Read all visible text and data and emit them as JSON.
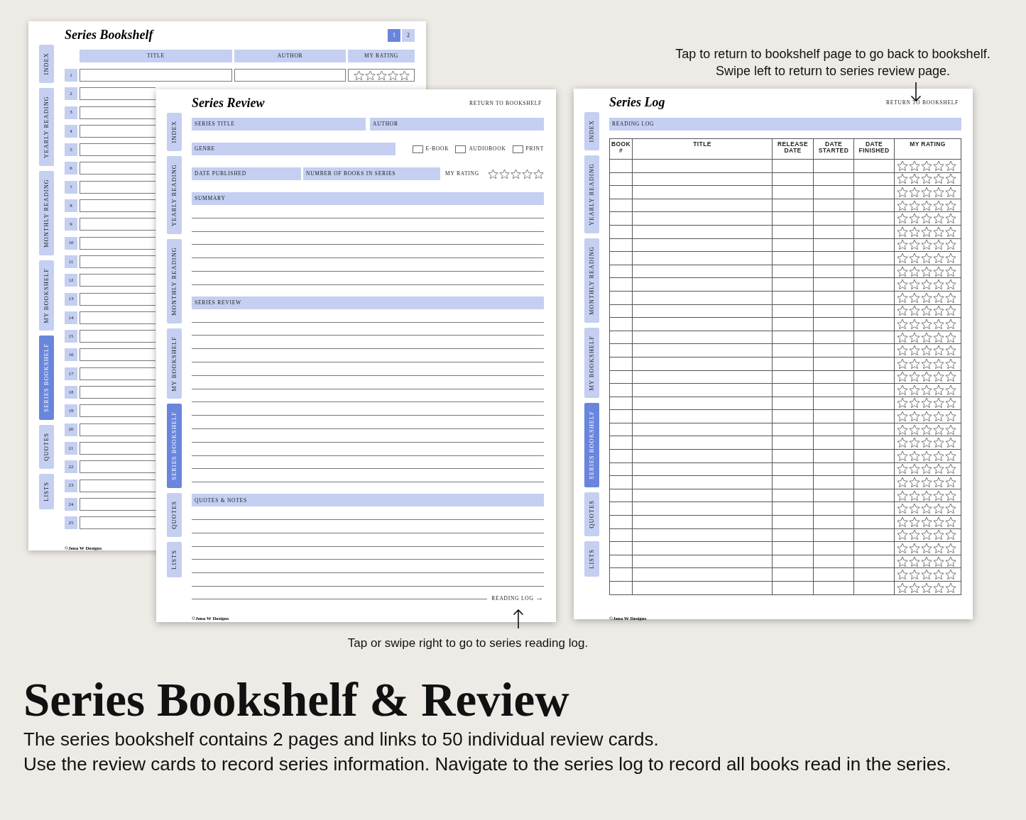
{
  "annotations": {
    "top_note": [
      "Tap to return to bookshelf page to go back to bookshelf.",
      "Swipe left to return to series review page."
    ],
    "bottom_note": "Tap or swipe right to go to series reading log."
  },
  "bookshelf_page": {
    "title": "Series Bookshelf",
    "page_buttons": [
      {
        "label": "1",
        "selected": true
      },
      {
        "label": "2",
        "selected": false
      }
    ],
    "tabs": [
      {
        "label": "INDEX",
        "selected": false
      },
      {
        "label": "YEARLY READING",
        "selected": false
      },
      {
        "label": "MONTHLY READING",
        "selected": false
      },
      {
        "label": "MY BOOKSHELF",
        "selected": false
      },
      {
        "label": "SERIES BOOKSHELF",
        "selected": true
      },
      {
        "label": "QUOTES",
        "selected": false
      },
      {
        "label": "LISTS",
        "selected": false
      }
    ],
    "columns": [
      "TITLE",
      "AUTHOR",
      "MY RATING"
    ],
    "rows": [
      {
        "number": "1",
        "stars": 0
      },
      {
        "number": "2"
      },
      {
        "number": "3"
      },
      {
        "number": "4"
      },
      {
        "number": "5"
      },
      {
        "number": "6"
      },
      {
        "number": "7"
      },
      {
        "number": "8"
      },
      {
        "number": "9"
      },
      {
        "number": "10"
      },
      {
        "number": "11"
      },
      {
        "number": "12"
      },
      {
        "number": "13"
      },
      {
        "number": "14"
      },
      {
        "number": "15"
      },
      {
        "number": "16"
      },
      {
        "number": "17"
      },
      {
        "number": "18"
      },
      {
        "number": "19"
      },
      {
        "number": "20"
      },
      {
        "number": "21"
      },
      {
        "number": "22"
      },
      {
        "number": "23"
      },
      {
        "number": "24"
      },
      {
        "number": "25"
      }
    ],
    "footer": "©Jena W Designs"
  },
  "review_page": {
    "title": "Series Review",
    "return_link": "RETURN TO BOOKSHELF",
    "tabs": [
      {
        "label": "INDEX",
        "selected": false
      },
      {
        "label": "YEARLY READING",
        "selected": false
      },
      {
        "label": "MONTHLY READING",
        "selected": false
      },
      {
        "label": "MY BOOKSHELF",
        "selected": false
      },
      {
        "label": "SERIES BOOKSHELF",
        "selected": true
      },
      {
        "label": "QUOTES",
        "selected": false
      },
      {
        "label": "LISTS",
        "selected": false
      }
    ],
    "series_title": "SERIES TITLE",
    "author": "AUTHOR",
    "genre": "GENRE",
    "formats": [
      {
        "label": "E-BOOK",
        "checked": false
      },
      {
        "label": "AUDIOBOOK",
        "checked": false
      },
      {
        "label": "PRINT",
        "checked": false
      }
    ],
    "date_published": "DATE PUBLISHED",
    "number_of_books": "NUMBER OF BOOKS IN SERIES",
    "rating_label": "MY RATING",
    "rating": {
      "stars": 0
    },
    "sections": [
      {
        "kind": "summary",
        "label": "SUMMARY"
      },
      {
        "kind": "review",
        "label": "SERIES REVIEW"
      },
      {
        "kind": "notes",
        "label": "QUOTES & NOTES"
      }
    ],
    "next_link": "READING LOG",
    "next_arrow": "→",
    "footer": "©Jena W Designs"
  },
  "log_page": {
    "title": "Series Log",
    "return_link": "RETURN TO BOOKSHELF",
    "tabs": [
      {
        "label": "INDEX",
        "selected": false
      },
      {
        "label": "YEARLY READING",
        "selected": false
      },
      {
        "label": "MONTHLY READING",
        "selected": false
      },
      {
        "label": "MY BOOKSHELF",
        "selected": false
      },
      {
        "label": "SERIES BOOKSHELF",
        "selected": true
      },
      {
        "label": "QUOTES",
        "selected": false
      },
      {
        "label": "LISTS",
        "selected": false
      }
    ],
    "section": "READING LOG",
    "columns": [
      [
        "BOOK",
        "#"
      ],
      [
        "TITLE"
      ],
      [
        "RELEASE",
        "DATE"
      ],
      [
        "DATE",
        "STARTED"
      ],
      [
        "DATE",
        "FINISHED"
      ],
      [
        "MY RATING"
      ]
    ],
    "rows": [
      {
        "stars": 0
      },
      {
        "stars": 0
      },
      {
        "stars": 0
      },
      {
        "stars": 0
      },
      {
        "stars": 0
      },
      {
        "stars": 0
      },
      {
        "stars": 0
      },
      {
        "stars": 0
      },
      {
        "stars": 0
      },
      {
        "stars": 0
      },
      {
        "stars": 0
      },
      {
        "stars": 0
      },
      {
        "stars": 0
      },
      {
        "stars": 0
      },
      {
        "stars": 0
      },
      {
        "stars": 0
      },
      {
        "stars": 0
      },
      {
        "stars": 0
      },
      {
        "stars": 0
      },
      {
        "stars": 0
      },
      {
        "stars": 0
      },
      {
        "stars": 0
      },
      {
        "stars": 0
      },
      {
        "stars": 0
      },
      {
        "stars": 0
      },
      {
        "stars": 0
      },
      {
        "stars": 0
      },
      {
        "stars": 0
      },
      {
        "stars": 0
      },
      {
        "stars": 0
      },
      {
        "stars": 0
      },
      {
        "stars": 0
      },
      {
        "stars": 0
      }
    ],
    "footer": "©Jena W Designs"
  },
  "heading": "Series Bookshelf & Review",
  "description": [
    "The series bookshelf contains 2 pages and links to 50 individual review cards.",
    "Use the review cards to record series information. Navigate to the series log to record all books read in the series."
  ]
}
